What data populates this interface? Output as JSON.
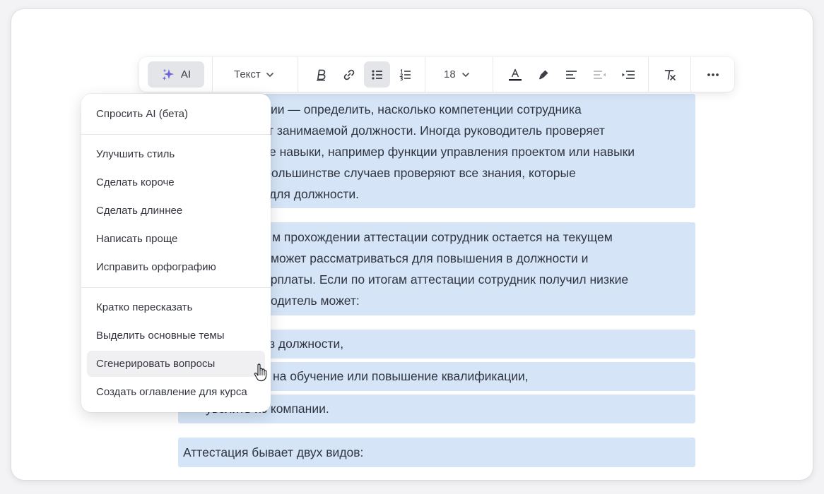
{
  "toolbar": {
    "ai_label": "AI",
    "style_label": "Текст",
    "size_label": "18",
    "icons": [
      "sparkles-icon",
      "chevron-down-icon",
      "bold-icon",
      "link-icon",
      "bullet-list-icon",
      "numbered-list-icon",
      "text-color-icon",
      "highlighter-icon",
      "align-left-icon",
      "outdent-icon",
      "indent-icon",
      "clear-format-icon",
      "more-icon"
    ],
    "accent_color": "#6c63d9"
  },
  "content": {
    "para1": [
      "ции — определить, насколько компетенции сотрудника",
      "т занимаемой должности. Иногда руководитель проверяет",
      "е навыки, например функции управления проектом или навыки",
      "большинстве случаев проверяют все знания, которые",
      "для должности."
    ],
    "para2": [
      "м прохождении аттестации сотрудник остается на текущем",
      "может рассматриваться для повышения в должности и",
      "арплаты. Если по итогам аттестации сотрудник получил низкие",
      "одитель может:"
    ],
    "list": [
      "з должности,",
      "на обучение или повышение квалификации,",
      "уволить из компании."
    ],
    "para3": "Аттестация бывает двух видов:"
  },
  "menu": {
    "items": [
      "Спросить AI (бета)",
      "Улучшить стиль",
      "Сделать короче",
      "Сделать длиннее",
      "Написать проще",
      "Исправить орфографию",
      "Кратко пересказать",
      "Выделить основные темы",
      "Сгенерировать вопросы",
      "Создать оглавление для курса"
    ],
    "hovered_item": "Сгенерировать вопросы"
  },
  "colors": {
    "selection": "#d5e5f7",
    "menu_hover": "#f0f0f2",
    "active_button": "#e4e5e8"
  }
}
